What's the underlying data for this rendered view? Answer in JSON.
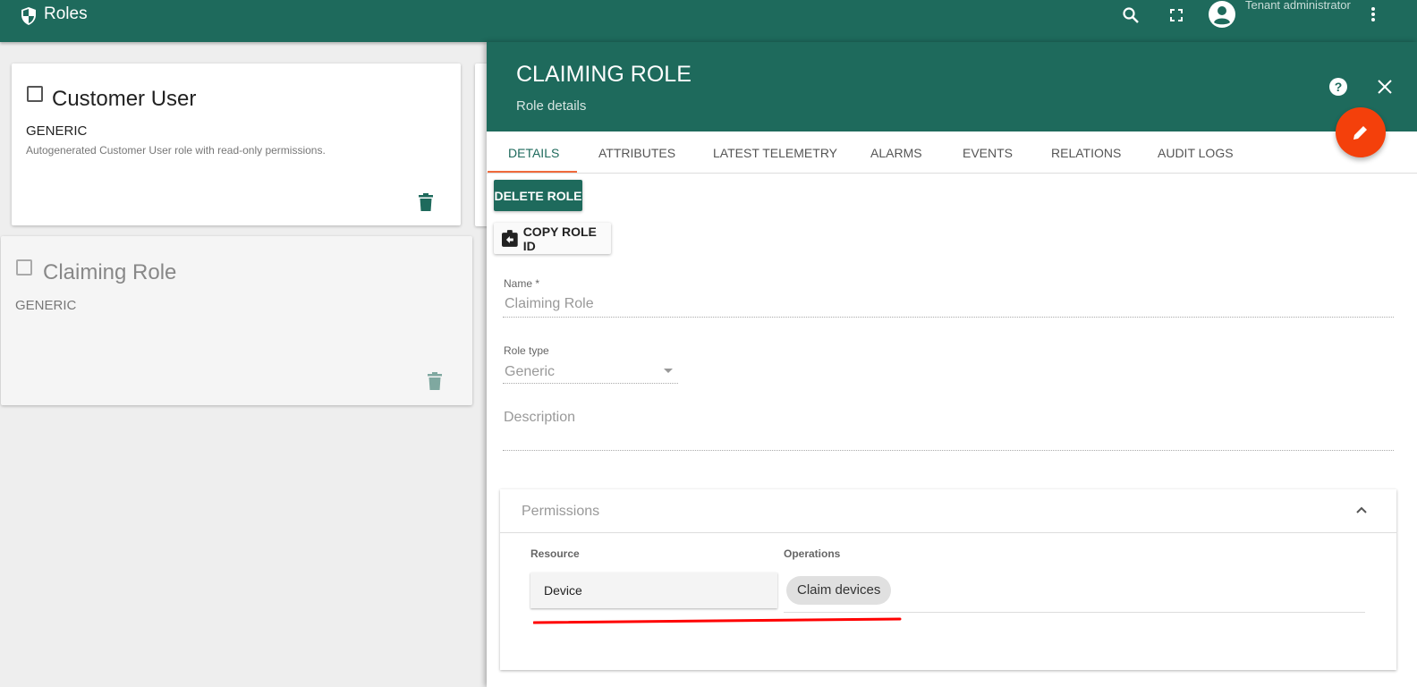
{
  "topbar": {
    "title": "Roles",
    "user_role": "Tenant administrator"
  },
  "cards": [
    {
      "name": "Customer User",
      "type": "GENERIC",
      "description": "Autogenerated Customer User role with read-only permissions."
    },
    {
      "name": "Claiming Role",
      "type": "GENERIC"
    }
  ],
  "details": {
    "title": "CLAIMING ROLE",
    "subtitle": "Role details",
    "tabs": [
      "Details",
      "Attributes",
      "Latest telemetry",
      "Alarms",
      "Events",
      "Relations",
      "Audit logs"
    ],
    "delete_label": "DELETE ROLE",
    "copy_label": "COPY ROLE ID",
    "name_label": "Name *",
    "name_value": "Claiming Role",
    "role_type_label": "Role type",
    "role_type_value": "Generic",
    "description_placeholder": "Description",
    "permissions": {
      "title": "Permissions",
      "resource_header": "Resource",
      "operations_header": "Operations",
      "resource": "Device",
      "operations": [
        "Claim devices"
      ]
    }
  },
  "colors": {
    "primary": "#1e6a5c",
    "accent": "#f4400b",
    "annotation": "#ff0000"
  }
}
